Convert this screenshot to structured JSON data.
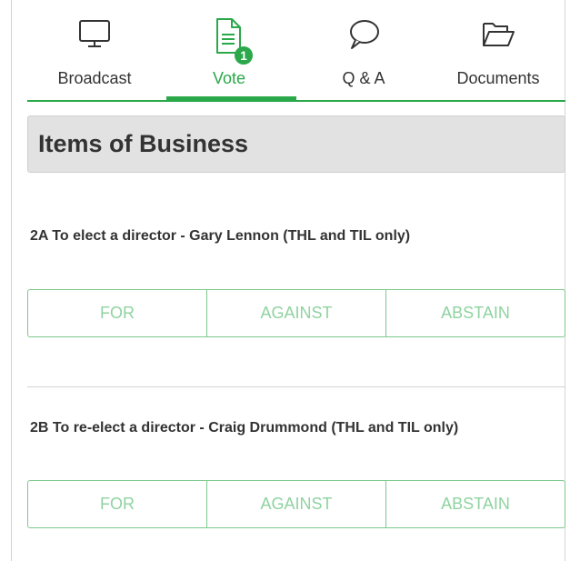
{
  "tabs": [
    {
      "label": "Broadcast",
      "icon": "monitor-icon",
      "active": false
    },
    {
      "label": "Vote",
      "icon": "document-icon",
      "active": true,
      "badge": "1"
    },
    {
      "label": "Q & A",
      "icon": "speech-bubble-icon",
      "active": false
    },
    {
      "label": "Documents",
      "icon": "folder-icon",
      "active": false
    }
  ],
  "section": {
    "title": "Items of Business"
  },
  "items": [
    {
      "title": "2A  To elect a director - Gary Lennon (THL and TIL only)",
      "options": [
        "FOR",
        "AGAINST",
        "ABSTAIN"
      ]
    },
    {
      "title": "2B  To re-elect a director - Craig Drummond (THL and TIL only)",
      "options": [
        "FOR",
        "AGAINST",
        "ABSTAIN"
      ]
    }
  ],
  "colors": {
    "accent": "#2aa84a",
    "vote_text": "#8fd3a0",
    "vote_border": "#7cc98d",
    "header_bg": "#e2e2e2"
  }
}
